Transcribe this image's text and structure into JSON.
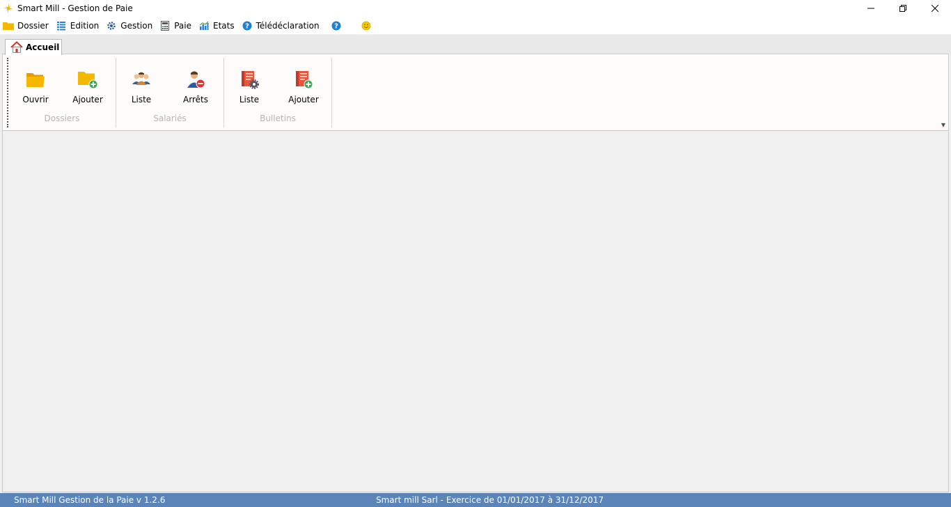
{
  "window": {
    "title": "Smart Mill - Gestion de Paie"
  },
  "menu": [
    {
      "label": "Dossier",
      "icon": "folder-icon",
      "color": "#f5b800"
    },
    {
      "label": "Edition",
      "icon": "list-icon",
      "color": "#2b7fd6"
    },
    {
      "label": "Gestion",
      "icon": "gear-icon",
      "color": "#2c5aa0"
    },
    {
      "label": "Paie",
      "icon": "calculator-icon",
      "color": "#555555"
    },
    {
      "label": "Etats",
      "icon": "chart-icon",
      "color": "#2b7fd6"
    },
    {
      "label": "Télédéclaration",
      "icon": "help-icon",
      "color": "#1e7fd9"
    },
    {
      "label": "",
      "icon": "help-icon",
      "color": "#1e7fd9"
    },
    {
      "label": "",
      "icon": "smiley-icon",
      "color": "#f5b800"
    }
  ],
  "ribbon": {
    "tab_label": "Accueil",
    "groups": [
      {
        "label": "Dossiers",
        "buttons": [
          {
            "label": "Ouvrir",
            "icon": "folder-open-icon"
          },
          {
            "label": "Ajouter",
            "icon": "folder-add-icon"
          }
        ]
      },
      {
        "label": "Salariés",
        "buttons": [
          {
            "label": "Liste",
            "icon": "employees-icon"
          },
          {
            "label": "Arrêts",
            "icon": "employee-stop-icon"
          }
        ]
      },
      {
        "label": "Bulletins",
        "buttons": [
          {
            "label": "Liste",
            "icon": "payslip-settings-icon"
          },
          {
            "label": "Ajouter",
            "icon": "payslip-add-icon"
          }
        ]
      }
    ]
  },
  "status": {
    "left": "Smart Mill Gestion de la Paie v 1.2.6",
    "center": "Smart mill Sarl - Exercice de 01/01/2017 à 31/12/2017"
  },
  "colors": {
    "accent": "#5b84b8",
    "folder": "#f5b800",
    "add": "#3aa655",
    "stop": "#e0332f",
    "payslip": "#e8573c"
  }
}
